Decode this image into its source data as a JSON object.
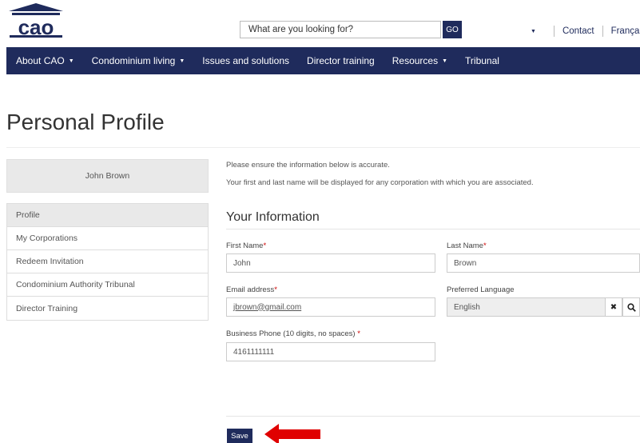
{
  "brand": {
    "logo_text": "cao",
    "primary_color": "#1f2b5c"
  },
  "header": {
    "search_placeholder": "What are you looking for?",
    "go_label": "GO",
    "contact_label": "Contact",
    "language_label": "Français"
  },
  "nav": [
    {
      "label": "About CAO",
      "has_menu": true
    },
    {
      "label": "Condominium living",
      "has_menu": true
    },
    {
      "label": "Issues and solutions",
      "has_menu": false
    },
    {
      "label": "Director training",
      "has_menu": false
    },
    {
      "label": "Resources",
      "has_menu": true
    },
    {
      "label": "Tribunal",
      "has_menu": false
    }
  ],
  "page": {
    "title": "Personal Profile"
  },
  "sidebar": {
    "user_name": "John Brown",
    "items": [
      {
        "label": "Profile",
        "active": true
      },
      {
        "label": "My Corporations"
      },
      {
        "label": "Redeem Invitation"
      },
      {
        "label": "Condominium Authority Tribunal"
      },
      {
        "label": "Director Training"
      }
    ]
  },
  "main": {
    "note1": "Please ensure the information below is accurate.",
    "note2": "Your first and last name will be displayed for any corporation with which you are associated.",
    "section_title": "Your Information",
    "fields": {
      "first_name": {
        "label": "First Name",
        "value": "John"
      },
      "last_name": {
        "label": "Last Name",
        "value": "Brown"
      },
      "email": {
        "label": "Email address",
        "value": "jbrown@gmail.com"
      },
      "language": {
        "label": "Preferred Language",
        "value": "English"
      },
      "phone": {
        "label": "Business Phone (10 digits, no spaces)",
        "value": "4161111111"
      }
    },
    "required_mark": "*",
    "save_label": "Save"
  }
}
